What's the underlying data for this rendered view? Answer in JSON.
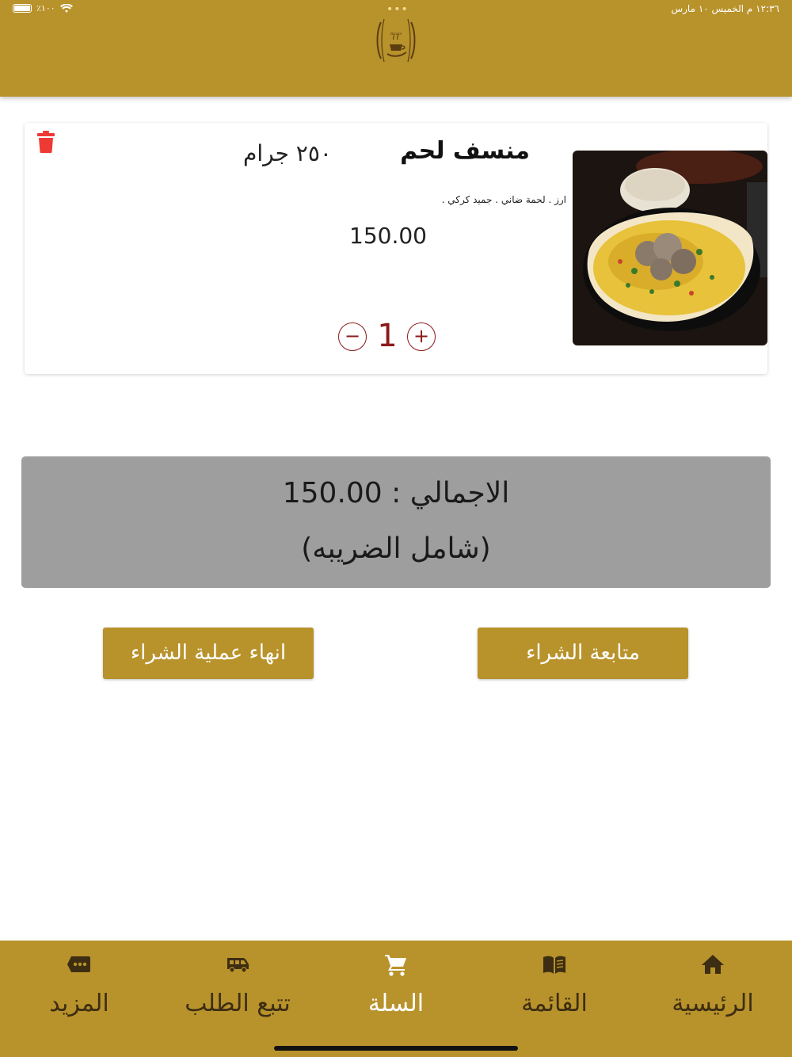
{
  "status_bar": {
    "time": "١٢:٣٦ م  الخميس ١٠ مارس",
    "battery": "٪١٠٠"
  },
  "header": {
    "logo_text": "Roots & Coffee",
    "menu_dots": "•••"
  },
  "cart": {
    "items": [
      {
        "name": "منسف لحم",
        "weight": "٢٥٠ جرام",
        "description": "ارز . لحمة ضاني . جميد كركي .",
        "price": "150.00",
        "quantity": "1",
        "minus_label": "−",
        "plus_label": "+"
      }
    ]
  },
  "summary": {
    "total_label": "الاجمالي : 150.00",
    "tax_note": "(شامل الضريبه)"
  },
  "actions": {
    "continue_label": "متابعة الشراء",
    "checkout_label": "انهاء عملية الشراء"
  },
  "bottom_nav": {
    "items": [
      {
        "label": "الرئيسية",
        "icon": "home-icon"
      },
      {
        "label": "القائمة",
        "icon": "menu-book-icon"
      },
      {
        "label": "السلة",
        "icon": "cart-icon",
        "active": true
      },
      {
        "label": "تتبع الطلب",
        "icon": "delivery-truck-icon"
      },
      {
        "label": "المزيد",
        "icon": "more-icon"
      }
    ]
  },
  "colors": {
    "brand": "#b8922b",
    "accent_red": "#8b1a1a",
    "delete_red": "#ee3a35",
    "total_bg": "#9e9e9e"
  }
}
